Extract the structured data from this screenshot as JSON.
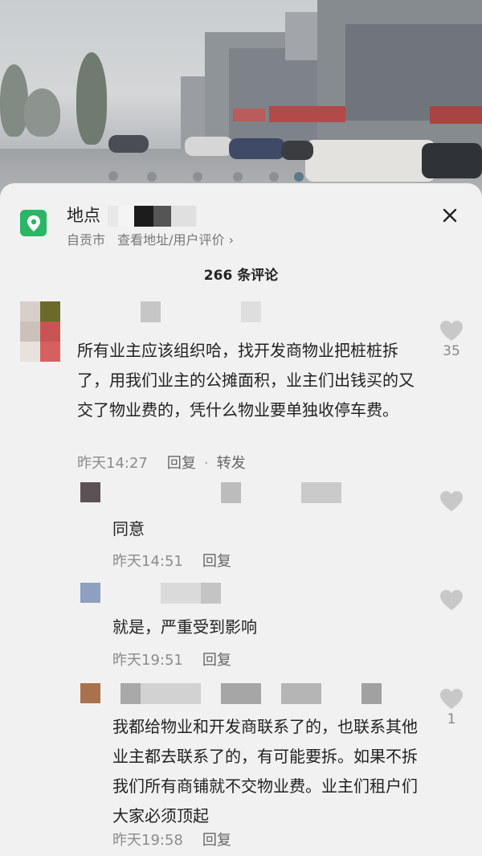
{
  "location": {
    "title": "地点",
    "city": "自贡市",
    "link": "查看地址/用户评价",
    "link_chevron": "›",
    "icon": "map-pin-icon",
    "accent": "#2ab664"
  },
  "close_icon": "close-icon",
  "comment_count": "266 条评论",
  "comments": [
    {
      "text": "所有业主应该组织哈，找开发商物业把桩桩拆了，用我们业主的公摊面积，业主们出钱买的又交了物业费的，凭什么物业要单独收停车费。",
      "time": "昨天14:27",
      "reply": "回复",
      "dot": "·",
      "share": "转发",
      "likes": "35"
    },
    {
      "text": "同意",
      "time": "昨天14:51",
      "reply": "回复",
      "likes": ""
    },
    {
      "text": "就是，严重受到影响",
      "time": "昨天19:51",
      "reply": "回复",
      "likes": ""
    },
    {
      "text": "我都给物业和开发商联系了的，也联系其他业主都去联系了的，有可能要拆。如果不拆我们所有商铺就不交物业费。业主们租户们大家必须顶起",
      "time": "昨天19:58",
      "reply": "回复",
      "likes": "1"
    }
  ]
}
